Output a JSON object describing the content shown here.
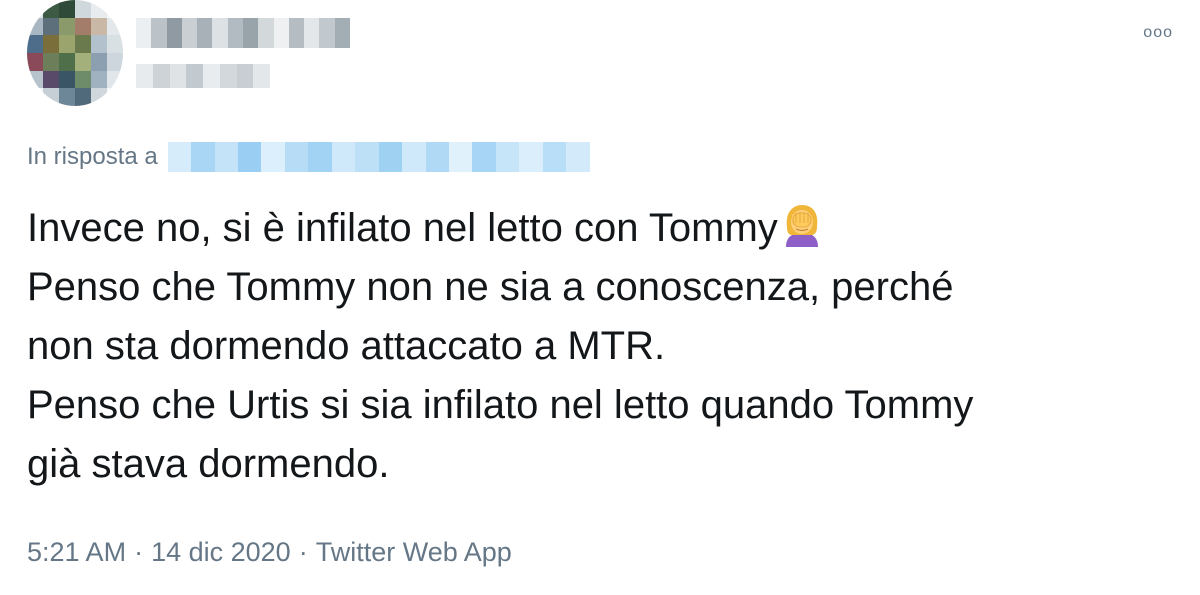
{
  "header": {
    "more_icon": "more-horizontal-icon",
    "more_label": "ooo"
  },
  "reply": {
    "prefix": "In risposta a"
  },
  "tweet": {
    "lines": [
      "Invece no, si è infilato nel letto con Tommy",
      "Penso che Tommy non ne sia a conoscenza, perché",
      "non sta dormendo attaccato a MTR.",
      "Penso che Urtis si sia infilato nel letto quando Tommy",
      "già stava dormendo."
    ],
    "emoji_icon": "face-palm-emoji-icon"
  },
  "meta": {
    "time": "5:21 AM",
    "date": "14 dic 2020",
    "source": "Twitter Web App",
    "separator": "·"
  },
  "colors": {
    "text": "#14171a",
    "secondary": "#657786",
    "link": "#1da1f2"
  }
}
